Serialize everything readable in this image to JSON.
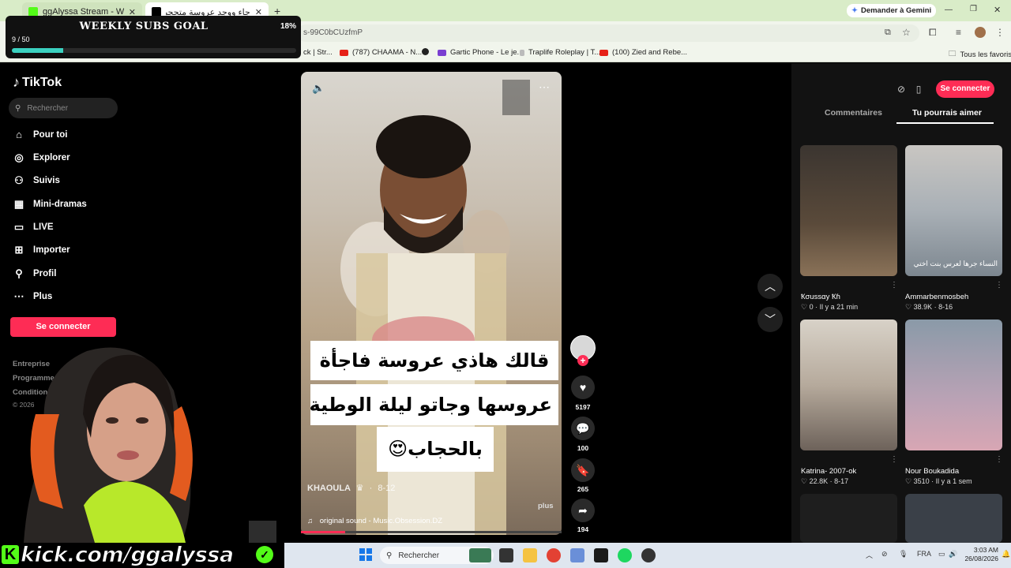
{
  "browser": {
    "tabs": [
      {
        "title": "ggAlyssa Stream - Watch Live o",
        "close": "✕"
      },
      {
        "title": "جاء ووجد عروسة متحجبة ...",
        "close": "✕"
      }
    ],
    "new_tab": "+",
    "gemini_button": "Demander à Gemini",
    "url": "s-99C0bCUzfmP",
    "bookmarks": [
      {
        "label": "ck | Str...",
        "color": "#555"
      },
      {
        "label": "(787) CHAAMA - N...",
        "color": "#e62117"
      },
      {
        "label": "",
        "color": "#222"
      },
      {
        "label": "Gartic Phone - Le je...",
        "color": "#7a3fd1"
      },
      {
        "label": "Traplife Roleplay | T...",
        "color": "#888"
      },
      {
        "label": "(100) Zied and Rebe...",
        "color": "#e62117"
      }
    ],
    "all_bookmarks": "Tous les favoris"
  },
  "goal": {
    "title": "WEEKLY SUBS GOAL",
    "percent_text": "18%",
    "count_text": "9 / 50",
    "progress": 0.18
  },
  "sidebar": {
    "logo": "TikTok",
    "search_placeholder": "Rechercher",
    "items": [
      {
        "label": "Pour toi",
        "icon": "home-icon"
      },
      {
        "label": "Explorer",
        "icon": "compass-icon"
      },
      {
        "label": "Suivis",
        "icon": "user-follow-icon"
      },
      {
        "label": "Mini-dramas",
        "icon": "film-icon"
      },
      {
        "label": "LIVE",
        "icon": "live-icon"
      },
      {
        "label": "Importer",
        "icon": "upload-icon"
      },
      {
        "label": "Profil",
        "icon": "profile-icon"
      },
      {
        "label": "Plus",
        "icon": "more-icon"
      }
    ],
    "login": "Se connecter",
    "footer": [
      "Entreprise",
      "Programme",
      "Condition",
      "© 2026"
    ]
  },
  "video": {
    "caption_lines": [
      "قالك هاذي عروسة فاجأة",
      "عروسها وجاتو ليلة الوطية",
      "بالحجاب😍"
    ],
    "author": "KHAOULA",
    "date": "8-12",
    "sound": "original sound - Music.Obsession.DZ",
    "more": "plus",
    "progress": 0.17,
    "likes": "5197",
    "comments": "100",
    "saves": "265",
    "shares": "194"
  },
  "right_panel": {
    "login": "Se connecter",
    "tabs": [
      "Commentaires",
      "Tu pourrais aimer"
    ],
    "active_tab": 1,
    "videos": [
      {
        "name": "Ҟσuѕѕαу Ҟɦ",
        "likes": "0",
        "time": "Il y a 21 min",
        "thumb_caption": ""
      },
      {
        "name": "Ammarbenmosbeh",
        "likes": "38.9K",
        "time": "8-16",
        "thumb_caption": "النساء جرها لعرس بنت اختي"
      },
      {
        "name": "Katrina- 2007-ok",
        "likes": "22.8K",
        "time": "8-17",
        "thumb_caption": ""
      },
      {
        "name": "Nour Boukadida",
        "likes": "3510",
        "time": "Il y a 1 sem",
        "thumb_caption": ""
      }
    ]
  },
  "stream": {
    "handle": "kick.com/ggalyssa"
  },
  "taskbar": {
    "search": "Rechercher",
    "lang": "FRA",
    "time": "3:03 AM",
    "date": "26/08/2026"
  }
}
